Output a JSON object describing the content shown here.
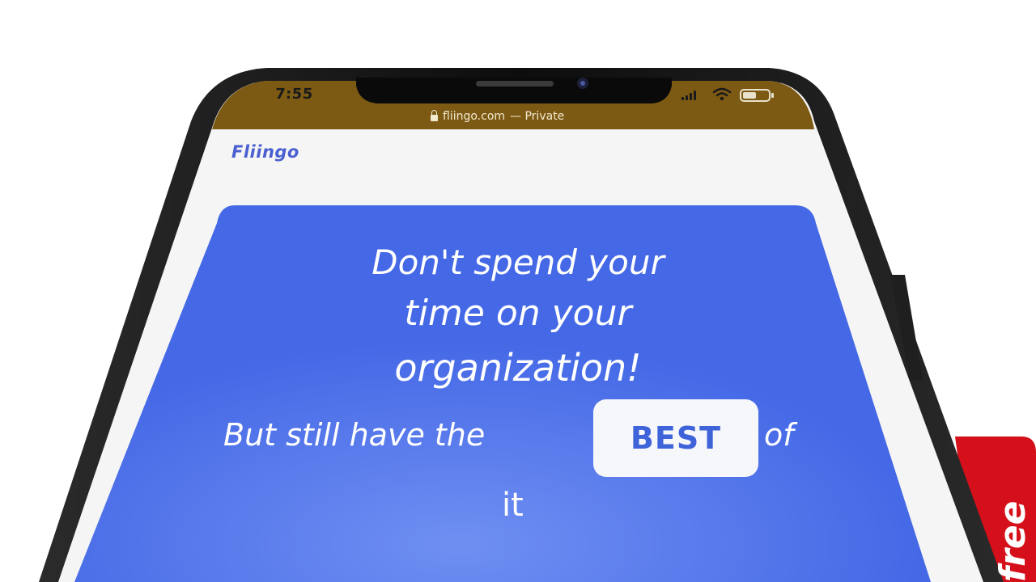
{
  "status_bar": {
    "time": "7:55"
  },
  "browser": {
    "url": "fliingo.com",
    "privacy_label": "— Private"
  },
  "header": {
    "brand": "Fliingo"
  },
  "hero": {
    "line1": "Don't spend your",
    "line2": "time on your",
    "line3": "organization!",
    "sub_prefix": "But still have the",
    "badge": "BEST",
    "sub_suffix": "of",
    "sub_end": "it"
  },
  "side_tab": {
    "label": "free"
  },
  "colors": {
    "status_bar_bg": "#7d5a14",
    "card_blue": "#4a6ee8",
    "brand_color": "#4a5fd0",
    "side_tab_red": "#d6101a",
    "page_bg": "#f5f5f5"
  },
  "icons": [
    "lock-icon",
    "signal-icon",
    "wifi-icon",
    "battery-icon",
    "camera-icon",
    "speaker-grille"
  ]
}
